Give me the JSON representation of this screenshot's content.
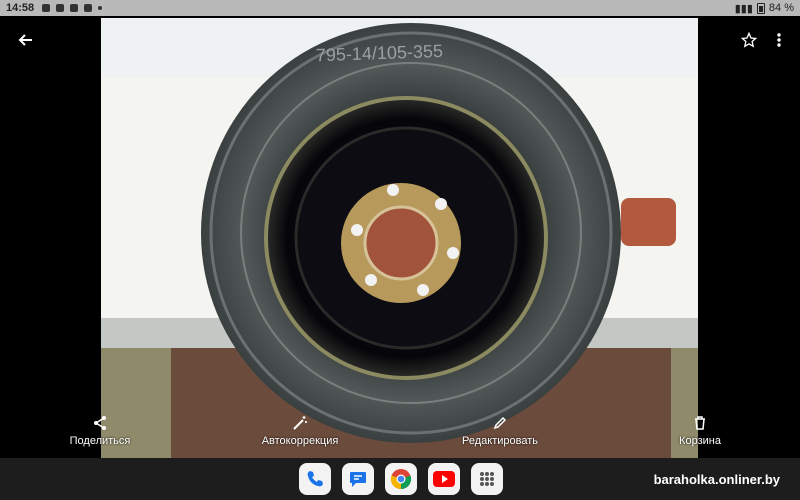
{
  "status": {
    "time": "14:58",
    "battery": "84 %"
  },
  "toolbar": {
    "back_icon": "arrow-left-icon",
    "favorite_icon": "star-outline-icon",
    "more_icon": "more-vert-icon"
  },
  "photo": {
    "tire_text": "795-14/105-355",
    "colors": {
      "sky": "#e9eef0",
      "wall": "#f5f5f3",
      "board": "#6b4b3b",
      "tire": "#4b5050",
      "rim": "#0d0d10",
      "hub": "#b79a5b"
    }
  },
  "actions": [
    {
      "label": "Поделиться",
      "icon": "share-icon"
    },
    {
      "label": "Автокоррекция",
      "icon": "magic-wand-icon"
    },
    {
      "label": "Редактировать",
      "icon": "edit-pencil-icon"
    },
    {
      "label": "Корзина",
      "icon": "trash-icon"
    }
  ],
  "dock": {
    "apps": [
      {
        "name": "phone",
        "icon": "phone-icon",
        "color": "#1a73e8"
      },
      {
        "name": "messages",
        "icon": "messages-icon",
        "color": "#1a73e8"
      },
      {
        "name": "chrome",
        "icon": "chrome-icon",
        "color": "#db4437"
      },
      {
        "name": "youtube",
        "icon": "youtube-icon",
        "color": "#ff0000"
      },
      {
        "name": "apps",
        "icon": "app-grid-icon",
        "color": "#555555"
      }
    ],
    "watermark": "baraholka.onliner.by"
  }
}
